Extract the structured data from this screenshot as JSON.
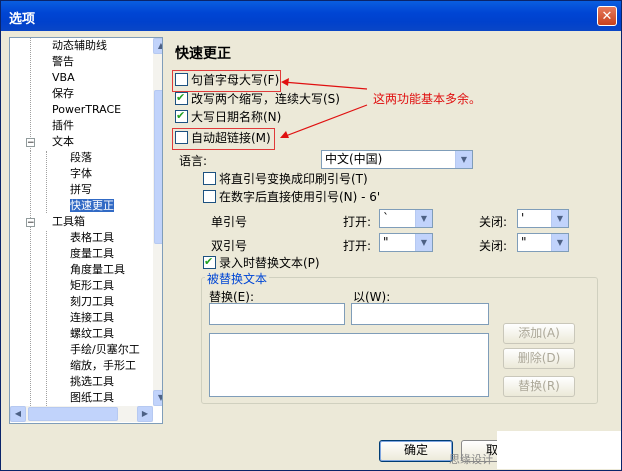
{
  "window": {
    "title": "选项",
    "close_glyph": "✕"
  },
  "tree": {
    "items": [
      {
        "label": "动态辅助线"
      },
      {
        "label": "警告"
      },
      {
        "label": "VBA"
      },
      {
        "label": "保存"
      },
      {
        "label": "PowerTRACE"
      },
      {
        "label": "插件"
      },
      {
        "label": "文本"
      },
      {
        "label": "段落"
      },
      {
        "label": "字体"
      },
      {
        "label": "拼写"
      },
      {
        "label": "快速更正"
      },
      {
        "label": "工具箱"
      },
      {
        "label": "表格工具"
      },
      {
        "label": "度量工具"
      },
      {
        "label": "角度量工具"
      },
      {
        "label": "矩形工具"
      },
      {
        "label": "刻刀工具"
      },
      {
        "label": "连接工具"
      },
      {
        "label": "螺纹工具"
      },
      {
        "label": "手绘/贝塞尔工"
      },
      {
        "label": "缩放，手形工"
      },
      {
        "label": "挑选工具"
      },
      {
        "label": "图纸工具"
      }
    ],
    "expander_glyph": "−"
  },
  "panel": {
    "heading": "快速更正",
    "checkboxes": {
      "capitalize_first": "句首字母大写(F)",
      "two_caps": "改写两个缩写，连续大写(S)",
      "capitalize_days": "大写日期名称(N)",
      "auto_hyperlink": "自动超链接(M)"
    },
    "annotation": "这两功能基本多余。",
    "language_label": "语言:",
    "language_value": "中文(中国)",
    "typographic_quotes": "将直引号变换成印刷引号(T)",
    "numbers_straight_quotes": "在数字后直接使用引号(N) - 6'",
    "single_quote_label": "单引号",
    "double_quote_label": "双引号",
    "open_label": "打开:",
    "close_label": "关闭:",
    "single_open": "`",
    "single_close": "'",
    "double_open": "\"",
    "double_close": "\"",
    "replace_as_type": "录入时替换文本(P)",
    "group_title": "被替换文本",
    "replace_label": "替换(E):",
    "with_label": "以(W):",
    "add_button": "添加(A)",
    "delete_button": "删除(D)",
    "replace_button": "替换(R)"
  },
  "footer": {
    "ok_button": "确定",
    "cancel_button": "取消",
    "footer_text": "思缘设计"
  },
  "icons": {
    "dropdown": "▼",
    "scroll_up": "▲",
    "scroll_down": "▼",
    "scroll_left": "◀",
    "scroll_right": "▶"
  }
}
